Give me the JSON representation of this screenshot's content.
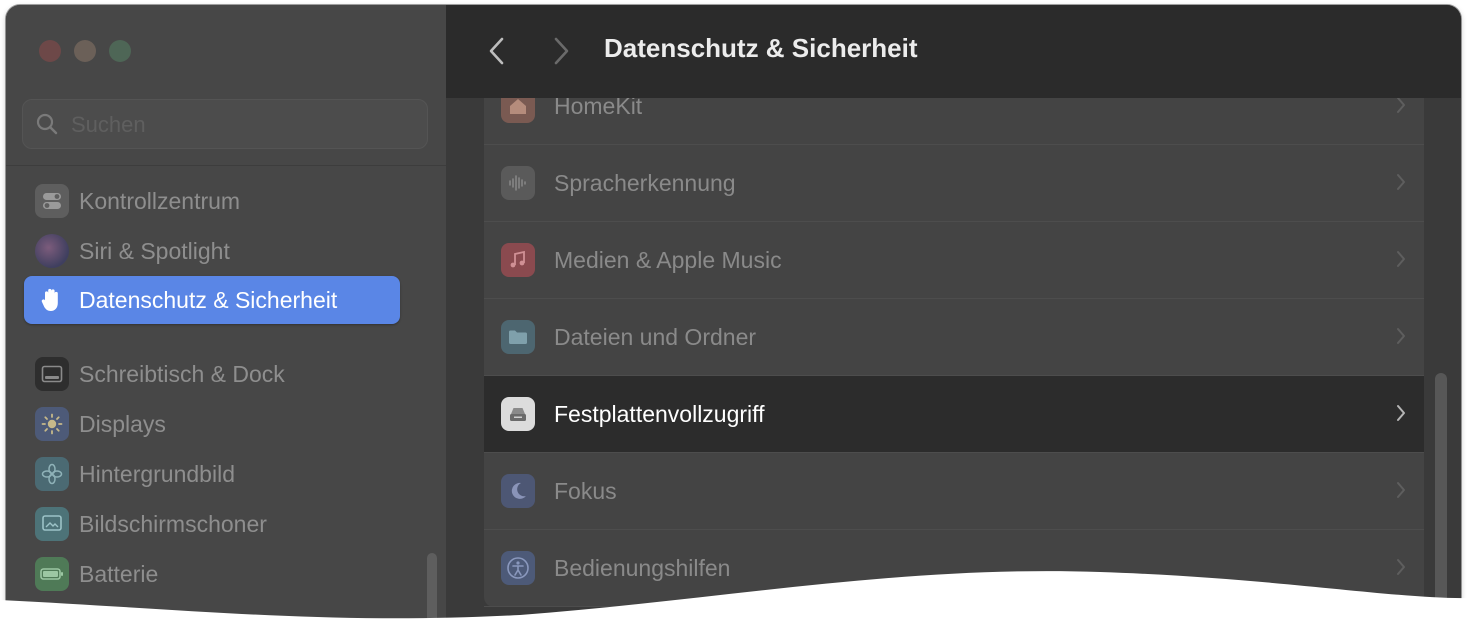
{
  "window": {
    "title": "Datenschutz & Sicherheit"
  },
  "colors": {
    "accent": "#5a86e6",
    "sidebar_bg": "#474747",
    "content_bg": "#3a3a3a",
    "highlight_row": "#2c2c2c"
  },
  "search": {
    "placeholder": "Suchen"
  },
  "sidebar": {
    "items": [
      {
        "label": "Kontrollzentrum",
        "icon": "control-center-icon"
      },
      {
        "label": "Siri & Spotlight",
        "icon": "siri-icon"
      },
      {
        "label": "Datenschutz & Sicherheit",
        "icon": "hand-icon",
        "active": true
      },
      {
        "label": "Schreibtisch & Dock",
        "icon": "dock-icon"
      },
      {
        "label": "Displays",
        "icon": "sun-icon"
      },
      {
        "label": "Hintergrundbild",
        "icon": "flower-icon"
      },
      {
        "label": "Bildschirmschoner",
        "icon": "screensaver-icon"
      },
      {
        "label": "Batterie",
        "icon": "battery-icon"
      }
    ]
  },
  "main": {
    "rows": [
      {
        "label": "HomeKit",
        "icon": "home-icon"
      },
      {
        "label": "Spracherkennung",
        "icon": "waveform-icon"
      },
      {
        "label": "Medien & Apple Music",
        "icon": "music-note-icon"
      },
      {
        "label": "Dateien und Ordner",
        "icon": "folder-icon"
      },
      {
        "label": "Festplattenvollzugriff",
        "icon": "disk-icon",
        "highlighted": true
      },
      {
        "label": "Fokus",
        "icon": "moon-icon"
      },
      {
        "label": "Bedienungshilfen",
        "icon": "accessibility-icon"
      }
    ]
  }
}
